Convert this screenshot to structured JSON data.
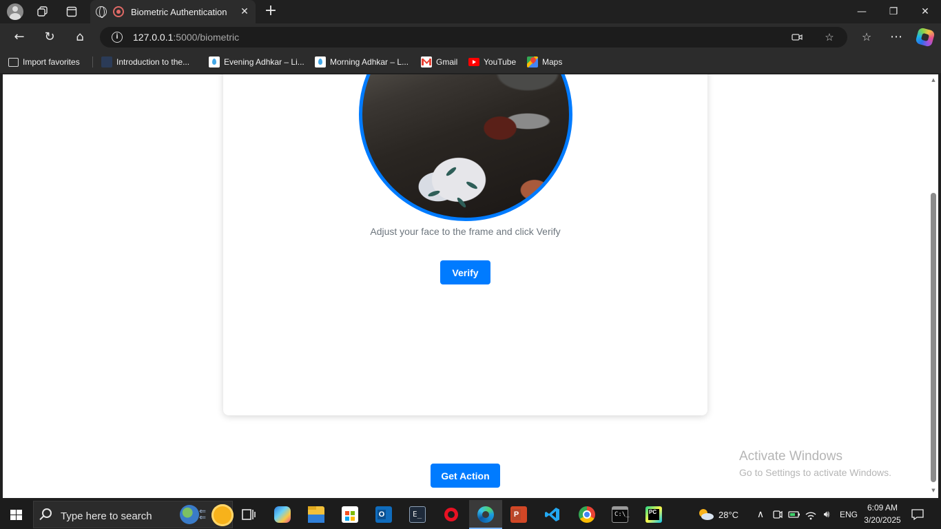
{
  "browser": {
    "tab": {
      "title": "Biometric Authentication",
      "close_label": "✕"
    },
    "new_tab_label": "+",
    "window_controls": {
      "minimize": "—",
      "maximize": "❐",
      "close": "✕"
    },
    "nav": {
      "back": "←",
      "reload": "↻",
      "home": "⌂"
    },
    "address": {
      "host": "127.0.0.1",
      "rest": ":5000/biometric"
    },
    "omni_icons": {
      "camera": "▭",
      "favorite": "☆"
    },
    "toolbar": {
      "favorites": "☆",
      "more": "⋯"
    },
    "favorites": [
      {
        "label": "Import favorites",
        "icon": "import-icon"
      },
      {
        "label": "Introduction to the...",
        "icon": "page-icon"
      },
      {
        "label": "Evening Adhkar – Li...",
        "icon": "drop-icon"
      },
      {
        "label": "Morning Adhkar – L...",
        "icon": "drop-icon"
      },
      {
        "label": "Gmail",
        "icon": "gmail-icon"
      },
      {
        "label": "YouTube",
        "icon": "youtube-icon"
      },
      {
        "label": "Maps",
        "icon": "maps-icon"
      }
    ]
  },
  "page": {
    "instructions": "Adjust your face to the frame and click Verify",
    "verify_label": "Verify",
    "action_label": "Get Action",
    "accent_color": "#007bff"
  },
  "watermark": {
    "line1": "Activate Windows",
    "line2": "Go to Settings to activate Windows."
  },
  "taskbar": {
    "search_placeholder": "Type here to search",
    "temperature": "28°C",
    "language": "ENG",
    "time": "6:09 AM",
    "date": "3/20/2025",
    "apps": [
      "task-view",
      "copilot",
      "file-explorer",
      "microsoft-store",
      "outlook",
      "terminal-e",
      "recorder",
      "edge",
      "powerpoint",
      "vscode",
      "chrome",
      "command-prompt",
      "pycharm"
    ]
  }
}
